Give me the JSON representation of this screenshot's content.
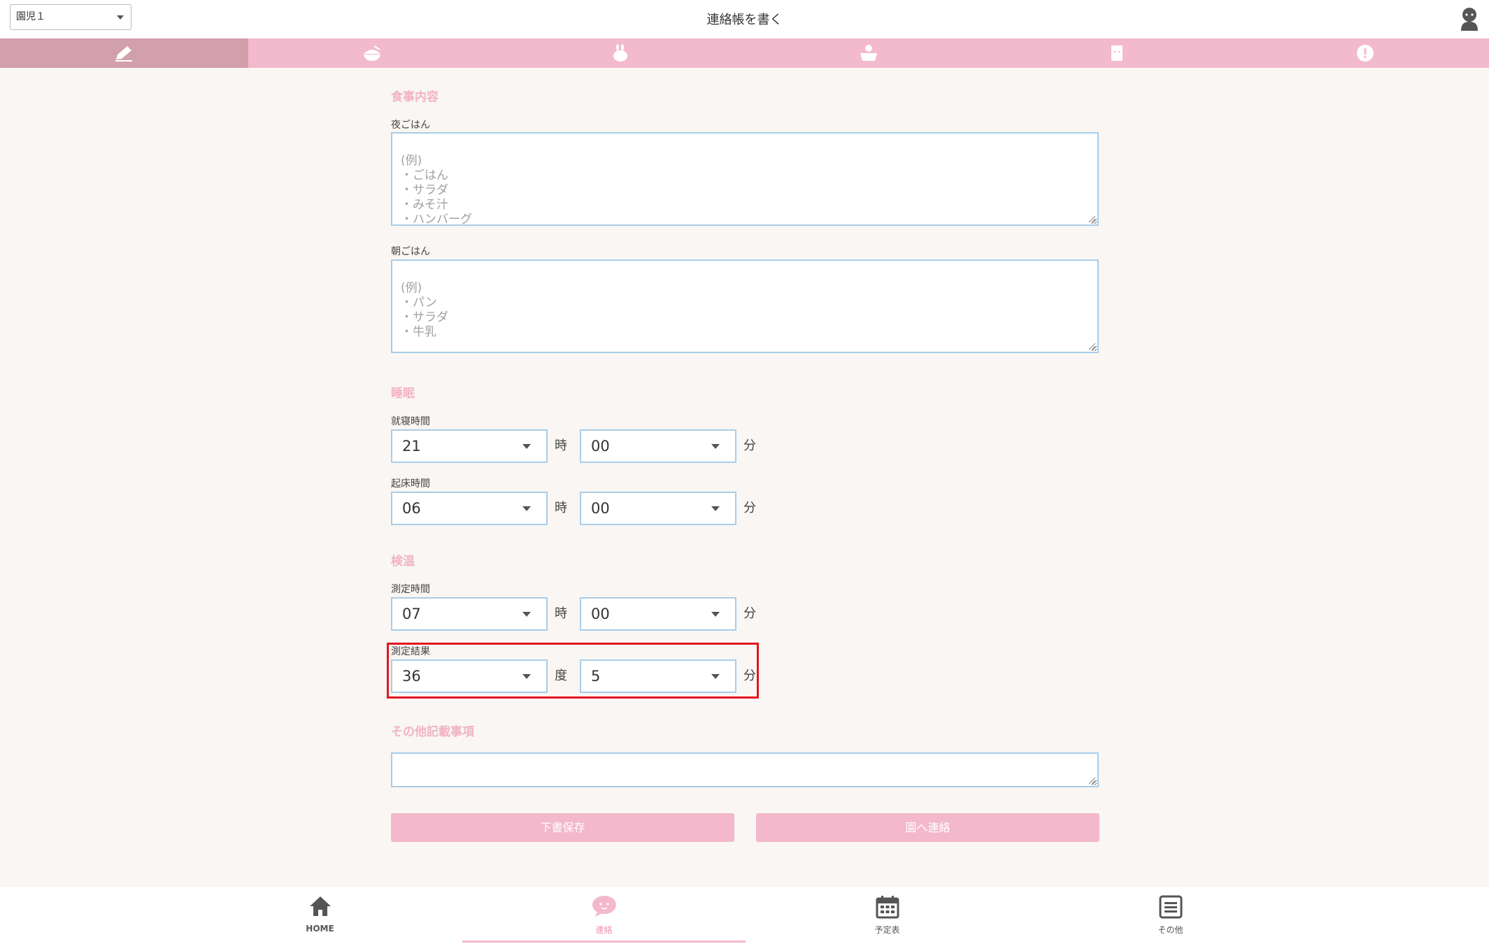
{
  "header": {
    "child_select": "園児１",
    "title": "連絡帳を書く"
  },
  "tabs": [
    {
      "icon": "pencil-icon",
      "active": true
    },
    {
      "icon": "bowl-icon",
      "active": false
    },
    {
      "icon": "rabbit-icon",
      "active": false
    },
    {
      "icon": "bath-icon",
      "active": false
    },
    {
      "icon": "note-icon",
      "active": false
    },
    {
      "icon": "alert-icon",
      "active": false
    }
  ],
  "meals": {
    "section_title": "食事内容",
    "dinner_label": "夜ごはん",
    "dinner_placeholder": "(例)\n・ごはん\n・サラダ\n・みそ汁\n・ハンバーグ",
    "breakfast_label": "朝ごはん",
    "breakfast_placeholder": "(例)\n・パン\n・サラダ\n・牛乳"
  },
  "sleep": {
    "section_title": "睡眠",
    "bedtime_label": "就寝時間",
    "bedtime_hour": "21",
    "bedtime_minute": "00",
    "wake_label": "起床時間",
    "wake_hour": "06",
    "wake_minute": "00",
    "hour_unit": "時",
    "minute_unit": "分"
  },
  "temperature": {
    "section_title": "検温",
    "time_label": "測定時間",
    "time_hour": "07",
    "time_minute": "00",
    "result_label": "測定結果",
    "result_degree": "36",
    "result_decimal": "5",
    "degree_unit": "度",
    "decimal_unit": "分",
    "hour_unit": "時",
    "minute_unit": "分"
  },
  "notes": {
    "section_title": "その他記載事項",
    "value": ""
  },
  "buttons": {
    "save_draft": "下書保存",
    "send": "園へ連絡"
  },
  "bottom_nav": {
    "home": "HOME",
    "contact": "連絡",
    "schedule": "予定表",
    "other": "その他"
  },
  "colors": {
    "accent_pink": "#f3b9cc",
    "active_tab": "#d29fad",
    "field_border": "#a9cde8",
    "highlight": "#e2161f",
    "background": "#f9f6f3"
  }
}
